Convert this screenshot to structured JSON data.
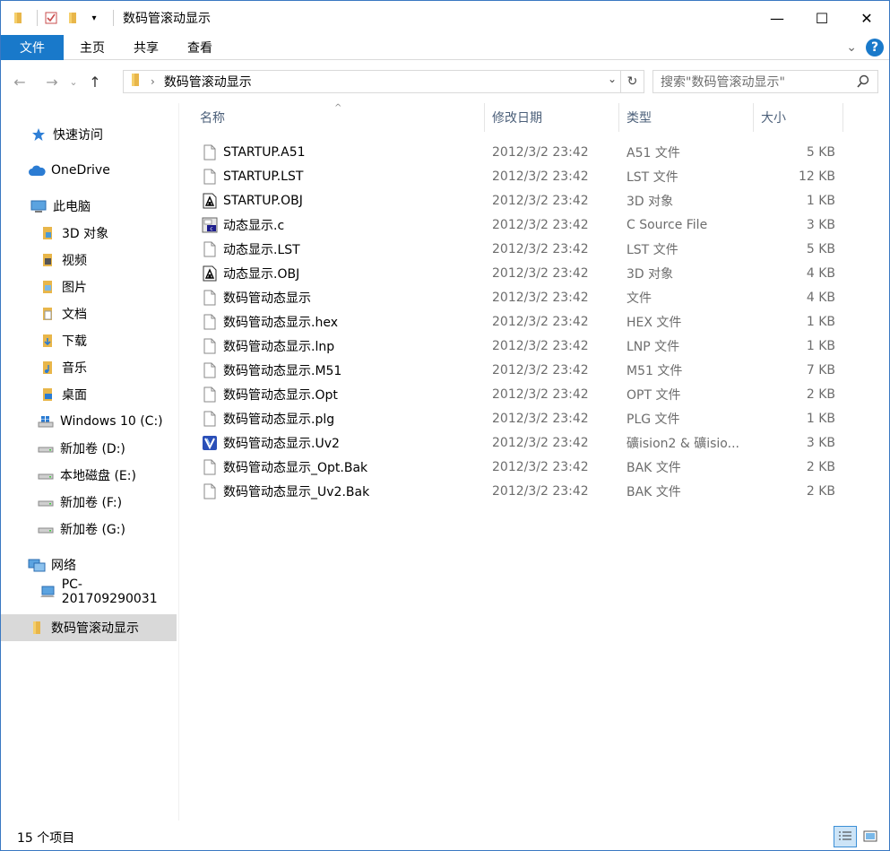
{
  "window": {
    "title": "数码管滚动显示",
    "minimize": "—",
    "maximize": "☐",
    "close": "✕"
  },
  "ribbon": {
    "file": "文件",
    "tabs": [
      "主页",
      "共享",
      "查看"
    ],
    "help": "?"
  },
  "address": {
    "path": "数码管滚动显示",
    "search_placeholder": "搜索\"数码管滚动显示\""
  },
  "nav": {
    "quick_access": "快速访问",
    "onedrive": "OneDrive",
    "this_pc": "此电脑",
    "items": [
      "3D 对象",
      "视频",
      "图片",
      "文档",
      "下载",
      "音乐",
      "桌面",
      "Windows 10 (C:)",
      "新加卷 (D:)",
      "本地磁盘 (E:)",
      "新加卷 (F:)",
      "新加卷 (G:)"
    ],
    "network": "网络",
    "pc": "PC-201709290031",
    "current": "数码管滚动显示"
  },
  "columns": {
    "name": "名称",
    "date": "修改日期",
    "type": "类型",
    "size": "大小"
  },
  "files": [
    {
      "name": "STARTUP.A51",
      "date": "2012/3/2 23:42",
      "type": "A51 文件",
      "size": "5 KB",
      "icon": "file"
    },
    {
      "name": "STARTUP.LST",
      "date": "2012/3/2 23:42",
      "type": "LST 文件",
      "size": "12 KB",
      "icon": "file"
    },
    {
      "name": "STARTUP.OBJ",
      "date": "2012/3/2 23:42",
      "type": "3D 对象",
      "size": "1 KB",
      "icon": "obj"
    },
    {
      "name": "动态显示.c",
      "date": "2012/3/2 23:42",
      "type": "C Source File",
      "size": "3 KB",
      "icon": "c"
    },
    {
      "name": "动态显示.LST",
      "date": "2012/3/2 23:42",
      "type": "LST 文件",
      "size": "5 KB",
      "icon": "file"
    },
    {
      "name": "动态显示.OBJ",
      "date": "2012/3/2 23:42",
      "type": "3D 对象",
      "size": "4 KB",
      "icon": "obj"
    },
    {
      "name": "数码管动态显示",
      "date": "2012/3/2 23:42",
      "type": "文件",
      "size": "4 KB",
      "icon": "file"
    },
    {
      "name": "数码管动态显示.hex",
      "date": "2012/3/2 23:42",
      "type": "HEX 文件",
      "size": "1 KB",
      "icon": "file"
    },
    {
      "name": "数码管动态显示.lnp",
      "date": "2012/3/2 23:42",
      "type": "LNP 文件",
      "size": "1 KB",
      "icon": "file"
    },
    {
      "name": "数码管动态显示.M51",
      "date": "2012/3/2 23:42",
      "type": "M51 文件",
      "size": "7 KB",
      "icon": "file"
    },
    {
      "name": "数码管动态显示.Opt",
      "date": "2012/3/2 23:42",
      "type": "OPT 文件",
      "size": "2 KB",
      "icon": "file"
    },
    {
      "name": "数码管动态显示.plg",
      "date": "2012/3/2 23:42",
      "type": "PLG 文件",
      "size": "1 KB",
      "icon": "file"
    },
    {
      "name": "数码管动态显示.Uv2",
      "date": "2012/3/2 23:42",
      "type": "礦ision2 & 礦isio...",
      "size": "3 KB",
      "icon": "uv2"
    },
    {
      "name": "数码管动态显示_Opt.Bak",
      "date": "2012/3/2 23:42",
      "type": "BAK 文件",
      "size": "2 KB",
      "icon": "file"
    },
    {
      "name": "数码管动态显示_Uv2.Bak",
      "date": "2012/3/2 23:42",
      "type": "BAK 文件",
      "size": "2 KB",
      "icon": "file"
    }
  ],
  "status": {
    "count": "15 个项目"
  }
}
